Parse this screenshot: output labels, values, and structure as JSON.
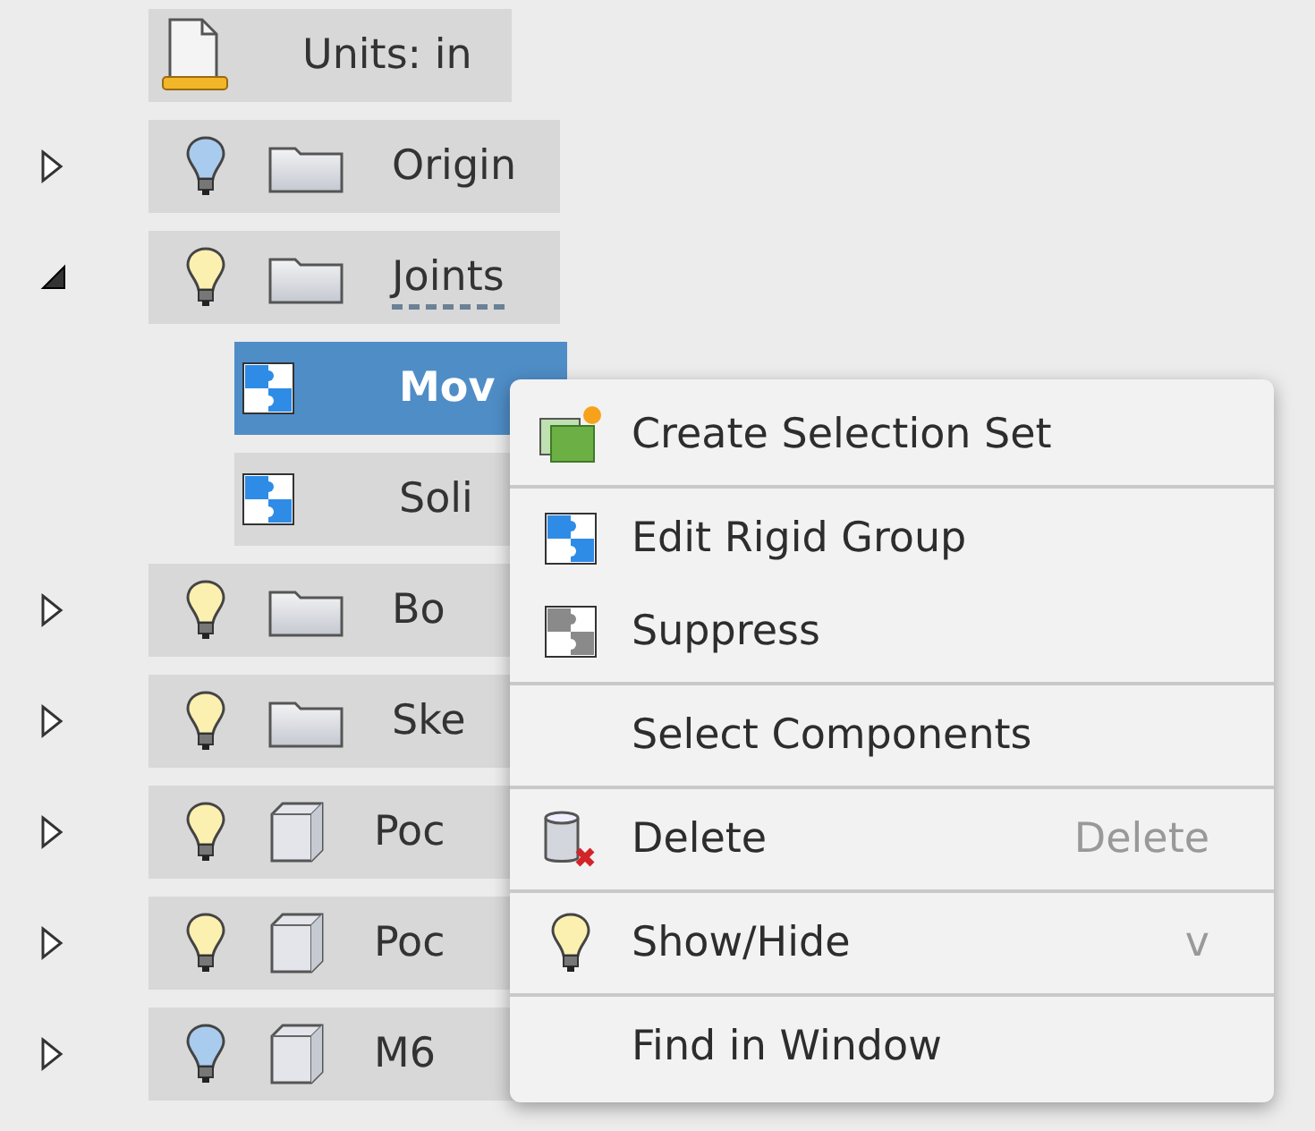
{
  "tree": [
    {
      "kind": "units",
      "label": "Units: in"
    },
    {
      "kind": "folder",
      "label": "Origin",
      "expanded": false,
      "lit": false,
      "underlined": false
    },
    {
      "kind": "folder",
      "label": "Joints",
      "expanded": true,
      "lit": true,
      "underlined": true,
      "children": [
        {
          "kind": "joint",
          "label": "Mov",
          "selected": true
        },
        {
          "kind": "joint",
          "label": "Soli",
          "selected": false
        }
      ]
    },
    {
      "kind": "folder",
      "label": "Bo",
      "expanded": false,
      "lit": true,
      "underlined": false
    },
    {
      "kind": "folder",
      "label": "Ske",
      "expanded": false,
      "lit": true,
      "underlined": false
    },
    {
      "kind": "component",
      "label": "Poc",
      "expanded": false,
      "lit": true,
      "underlined": false
    },
    {
      "kind": "component",
      "label": "Poc",
      "expanded": false,
      "lit": true,
      "underlined": false
    },
    {
      "kind": "component",
      "label": "M6",
      "expanded": false,
      "lit": false,
      "underlined": false
    }
  ],
  "context_menu": {
    "groups": [
      [
        {
          "label": "Create Selection Set"
        }
      ],
      [
        {
          "label": "Edit Rigid Group"
        },
        {
          "label": "Suppress"
        }
      ],
      [
        {
          "label": "Select Components"
        }
      ],
      [
        {
          "label": "Delete",
          "shortcut": "Delete"
        }
      ],
      [
        {
          "label": "Show/Hide",
          "shortcut": "v"
        }
      ],
      [
        {
          "label": "Find in Window"
        }
      ]
    ]
  }
}
